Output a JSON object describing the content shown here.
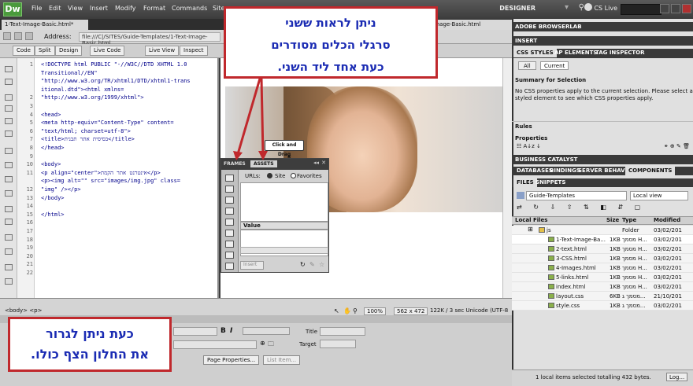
{
  "app": {
    "logo": "Dw",
    "menus": [
      "File",
      "Edit",
      "View",
      "Insert",
      "Modify",
      "Format",
      "Commands",
      "Site"
    ],
    "workspace": "DESIGNER",
    "cslive": "CS Live"
  },
  "document": {
    "tab_title": "1-Text-Image-Basic.html*",
    "tab_title_right": "t-Image-Basic.html",
    "address_label": "Address:",
    "address_value": "file:///C|/SITES/Guide-Templates/1-Text-Image-Basic.html",
    "views": [
      "Code",
      "Split",
      "Design",
      "Live Code",
      "Live View",
      "Inspect"
    ]
  },
  "code": {
    "line_numbers": [
      "1",
      "",
      "",
      "",
      "2",
      "3",
      "4",
      "5",
      "6",
      "7",
      "8",
      "9",
      "10",
      "11",
      "",
      "12",
      "13",
      "14",
      "15",
      "16",
      "17",
      "18",
      "19",
      "20",
      "21",
      "22"
    ],
    "lines": [
      "<!DOCTYPE html PUBLIC \"-//W3C//DTD XHTML 1.0",
      "Transitional//EN\"",
      "\"http://www.w3.org/TR/xhtml1/DTD/xhtml1-trans",
      "itional.dtd\"><html xmlns=",
      "\"http://www.w3.org/1999/xhtml\">",
      "",
      "<head>",
      "<meta http-equiv=\"Content-Type\" content=",
      "\"text/html; charset=utf-8\">",
      "<title>בסיסית אתר תבנית</title>",
      "</head>",
      "",
      "<body>",
      "<p align=\"center\">אינטרנט אתר הקמת</p>",
      "<p><img alt=\"\" src=\"images/img.jpg\" class=",
      "\"img\" /></p>",
      "</body>",
      "",
      "</html>"
    ]
  },
  "tooltip": "Click and Drag",
  "assets_panel": {
    "tab_frames": "FRAMES",
    "tab_assets": "ASSETS",
    "urls_label": "URLs:",
    "site_radio": "Site",
    "favorites_radio": "Favorites",
    "value_header": "Value",
    "insert_button": "Insert"
  },
  "status": {
    "tag_selector": "<body> <p>",
    "zoom": "100%",
    "window_size": "562 x 472",
    "file_info": "122K / 3 sec  Unicode (UTF-8"
  },
  "properties": {
    "title_label": "Title",
    "target_label": "Target",
    "page_properties_button": "Page Properties...",
    "list_item_button": "List Item...",
    "bold": "B",
    "italic": "I"
  },
  "right_panel": {
    "browserlab": "ADOBE BROWSERLAB",
    "insert": "INSERT",
    "css_tabs": [
      "CSS STYLES",
      "AP ELEMENTS",
      "TAG INSPECTOR"
    ],
    "css_buttons": [
      "All",
      "Current"
    ],
    "summary_title": "Summary for Selection",
    "summary_text_1": "No CSS properties apply to the current selection.  Please select a",
    "summary_text_2": "styled element to see which CSS properties apply.",
    "rules_label": "Rules",
    "properties_label": "Properties",
    "business_catalyst": "BUSINESS CATALYST",
    "db_tabs": [
      "DATABASES",
      "BINDINGS",
      "SERVER BEHAVIOR",
      "COMPONENTS"
    ],
    "files_tabs": [
      "FILES",
      "SNIPPETS"
    ],
    "site_select": "Guide-Templates",
    "view_select": "Local view",
    "file_columns": [
      "Local Files",
      "Size",
      "Type",
      "Modified"
    ],
    "files": [
      {
        "name": "js",
        "size": "",
        "type": "Folder",
        "modified": "03/02/201"
      },
      {
        "name": "1-Text-Image-Ba...",
        "size": "1KB",
        "type": "מסמך H...",
        "modified": "03/02/201"
      },
      {
        "name": "2-text.html",
        "size": "1KB",
        "type": "מסמך H...",
        "modified": "03/02/201"
      },
      {
        "name": "3-CSS.html",
        "size": "1KB",
        "type": "מסמך H...",
        "modified": "03/02/201"
      },
      {
        "name": "4-Images.html",
        "size": "1KB",
        "type": "מסמך H...",
        "modified": "03/02/201"
      },
      {
        "name": "5-links.html",
        "size": "1KB",
        "type": "מסמך H...",
        "modified": "03/02/201"
      },
      {
        "name": "index.html",
        "size": "1KB",
        "type": "מסמך H...",
        "modified": "03/02/201"
      },
      {
        "name": "layout.css",
        "size": "6KB",
        "type": "מסמך ג...",
        "modified": "21/10/201"
      },
      {
        "name": "style.css",
        "size": "1KB",
        "type": "מסמך ג...",
        "modified": "03/02/201"
      }
    ],
    "footer_status": "1 local items selected totalling 432 bytes.",
    "log_button": "Log..."
  },
  "annotations": {
    "top_line1": "ניתן לראות ששני",
    "top_line2": "סרגלי הכלים מסודרים",
    "top_line3": "כעת אחד ליד השני.",
    "bottom_line1": "כעת ניתן לגרור",
    "bottom_line2": "את החלון הצף כולו."
  },
  "colors": {
    "annotation_border": "#c0282c",
    "annotation_text": "#1a2bb3",
    "chrome_dark": "#3a3a3a"
  }
}
